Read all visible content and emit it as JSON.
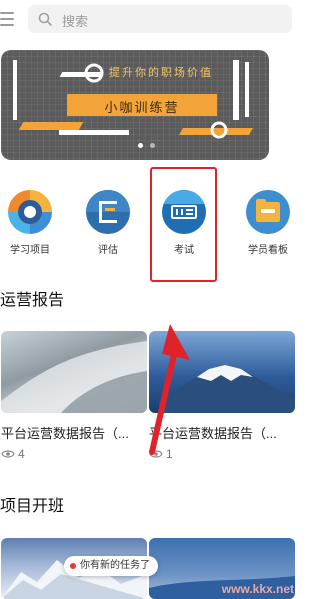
{
  "search": {
    "placeholder": "搜索"
  },
  "banner": {
    "slogan": "提升你的职场价值",
    "title": "小咖训练营",
    "page_count": 2,
    "active_page": 1
  },
  "quick_nav": [
    {
      "label": "学习项目",
      "icon": "learning-project-icon"
    },
    {
      "label": "评估",
      "icon": "evaluation-icon"
    },
    {
      "label": "考试",
      "icon": "exam-icon"
    },
    {
      "label": "学员看板",
      "icon": "student-board-icon"
    }
  ],
  "sections": {
    "operations_report": "运营报告",
    "project_classes": "项目开班"
  },
  "reports": [
    {
      "title": "平台运营数据报告（...",
      "views": "4"
    },
    {
      "title": "平台运营数据报告（...",
      "views": "1"
    }
  ],
  "toast": {
    "text": "你有新的任务了"
  },
  "watermark": "www.kkx.net",
  "colors": {
    "accent": "#f2a438",
    "highlight": "#e0232b",
    "banner_bg": "#5b5b5b"
  }
}
